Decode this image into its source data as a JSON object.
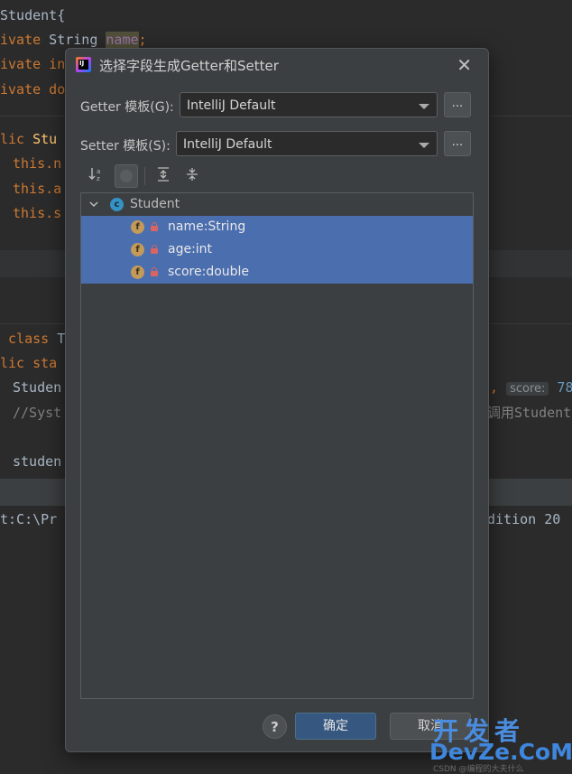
{
  "editor": {
    "line1": "Student{",
    "line2_a": "ivate",
    "line2_b": " String ",
    "line2_c": "name",
    "line2_d": ";",
    "line3_a": "ivate",
    "line3_b": " in",
    "line4_a": "ivate",
    "line4_b": " do",
    "line5_a": "lic",
    "line5_b": " Stu",
    "line6": "this.n",
    "line7": "this.a",
    "line8": "this.s",
    "line9_a": " class",
    "line9_b": " T",
    "line10_a": "lic",
    "line10_b": " sta",
    "line11_a": "Studen",
    "line11_b": "), ",
    "line11_hint": "score:",
    "line11_num": " 78",
    "line12_a": "//Syst",
    "line12_b": "调用Student类",
    "line13": "studen",
    "run_line_a": "t:C:\\Pr",
    "run_line_b": "dition 20"
  },
  "dialog": {
    "title": "选择字段生成Getter和Setter",
    "close_glyph": "✕",
    "getter_label": "Getter 模板(G):",
    "getter_value": "IntelliJ Default",
    "setter_label": "Setter 模板(S):",
    "setter_value": "IntelliJ Default",
    "browse_label": "...",
    "tree": {
      "class_name": "Student",
      "class_icon_letter": "c",
      "field_icon_letter": "f",
      "fields": [
        "name:String",
        "age:int",
        "score:double"
      ]
    },
    "help_glyph": "?",
    "ok_label": "确定",
    "cancel_label": "取消"
  },
  "watermark": {
    "line1": "开发者",
    "line2": "DevZe.CoM",
    "line3": "CSDN @编程的大夫什么"
  },
  "colors": {
    "selection": "#4b6eaf",
    "ok_button": "#365880",
    "dialog_bg": "#3c3f41"
  }
}
